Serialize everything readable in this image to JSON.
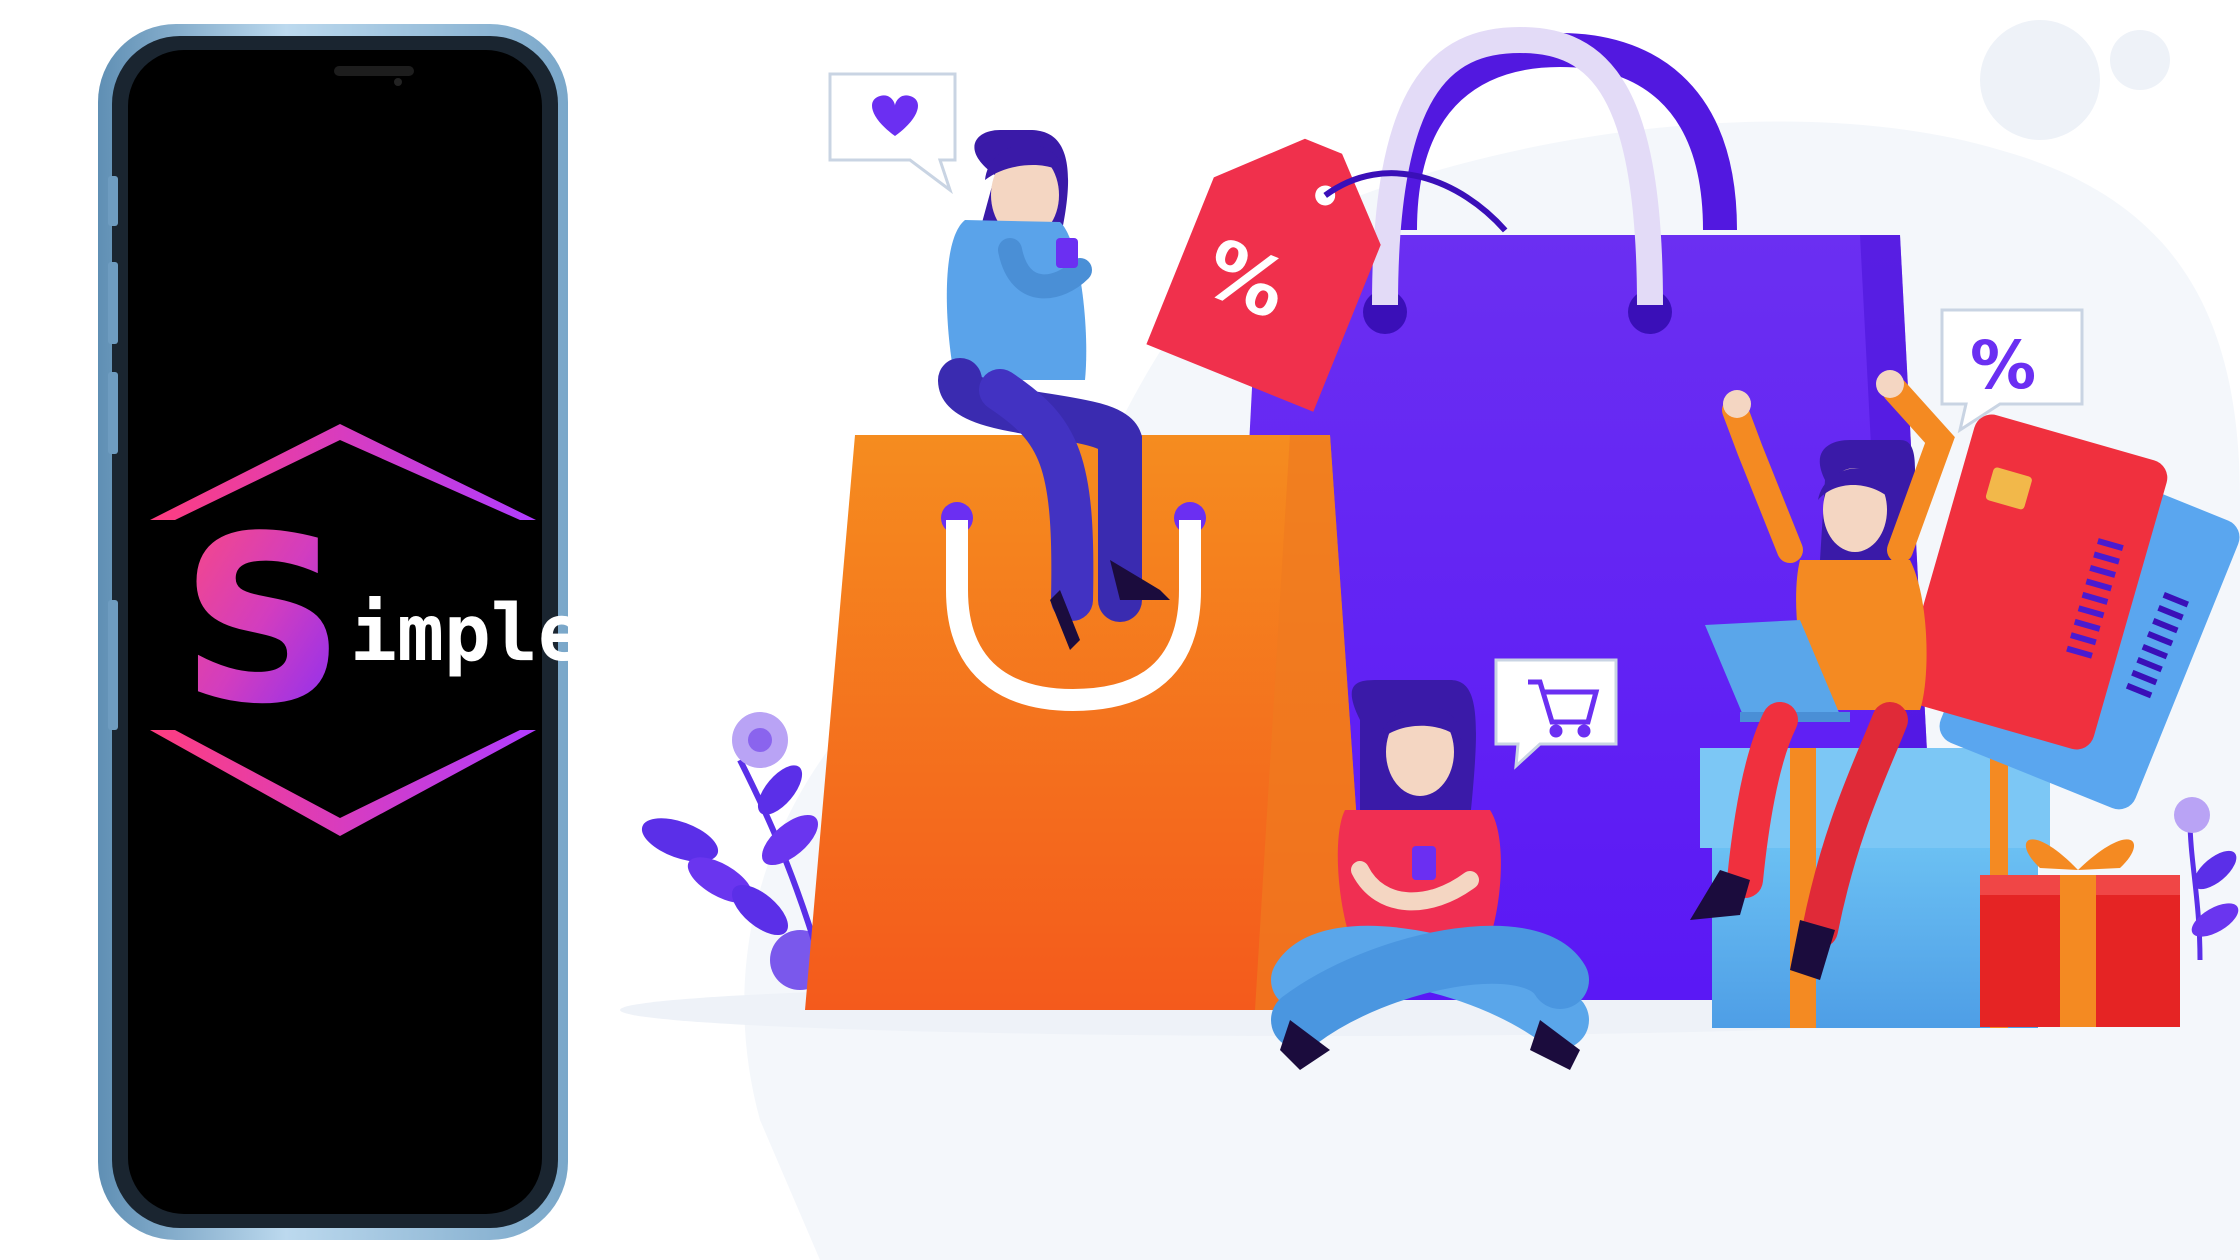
{
  "logo": {
    "letter": "S",
    "text": "imple"
  },
  "bubbles": {
    "percent_top": "%",
    "percent_tag": "%",
    "percent_right": "%"
  },
  "colors": {
    "phone_frame": "#8fb9d8",
    "screen": "#000000",
    "logo_gradient_start": "#ff3d7f",
    "logo_gradient_end": "#7a2cff",
    "orange_bag": "#f4731c",
    "purple_bag": "#6b2ff2",
    "price_tag": "#f0304c",
    "gift_blue": "#6bb8f0",
    "gift_red": "#f02a2a"
  },
  "icons": [
    "heart-icon",
    "cart-icon",
    "percent-icon",
    "credit-card-icon",
    "gift-icon"
  ]
}
